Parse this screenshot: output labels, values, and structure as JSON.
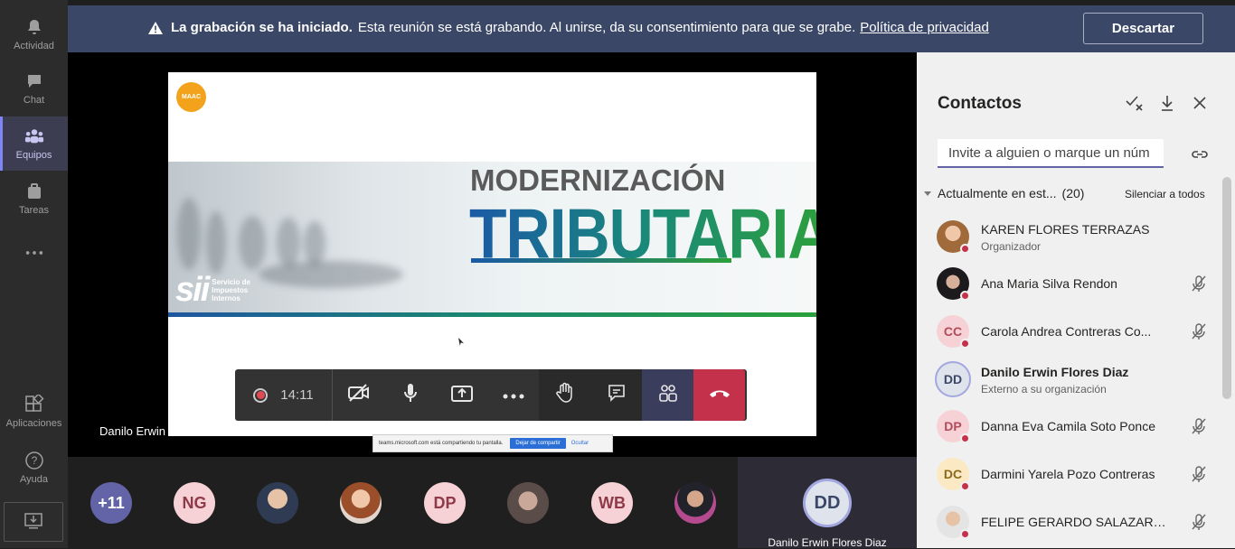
{
  "rail": {
    "items": [
      {
        "label": "Actividad",
        "icon": "bell-icon"
      },
      {
        "label": "Chat",
        "icon": "chat-icon"
      },
      {
        "label": "Equipos",
        "icon": "teams-icon"
      },
      {
        "label": "Tareas",
        "icon": "tasks-icon"
      },
      {
        "label": "...",
        "icon": "more-icon"
      },
      {
        "label": "Aplicaciones",
        "icon": "apps-icon"
      },
      {
        "label": "Ayuda",
        "icon": "help-icon"
      }
    ]
  },
  "banner": {
    "bold_text": "La grabación se ha iniciado.",
    "text": "Esta reunión se está grabando. Al unirse, da su consentimiento para que se grabe.",
    "link": "Política de privacidad",
    "dismiss_label": "Descartar"
  },
  "slide": {
    "logo_text": "MAAC",
    "title_line1": "MODERNIZACIÓN",
    "title_line2": "TRIBUTARIA",
    "org_short": "sii",
    "org_line1": "Servicio de",
    "org_line2": "Impuestos",
    "org_line3": "Internos"
  },
  "presenter_name": "Danilo Erwin Flores Diaz",
  "controls": {
    "timer": "14:11"
  },
  "share_toast": {
    "text": "teams.microsoft.com está compartiendo tu pantalla.",
    "stop_label": "Dejar de compartir",
    "hide_label": "Ocultar"
  },
  "strip": {
    "more": "+11",
    "tiles": [
      "NG",
      "DP",
      "WB"
    ],
    "self_initials": "DD",
    "self_name": "Danilo Erwin Flores Diaz"
  },
  "panel": {
    "title": "Contactos",
    "invite_placeholder": "Invite a alguien o marque un núm",
    "section_label": "Actualmente en est...",
    "section_count": "(20)",
    "mute_all": "Silenciar a todos",
    "contacts": [
      {
        "name": "KAREN FLORES TERRAZAS",
        "sub": "Organizador",
        "initials": ""
      },
      {
        "name": "Ana Maria Silva Rendon",
        "sub": "",
        "initials": ""
      },
      {
        "name": "Carola Andrea Contreras Co...",
        "sub": "",
        "initials": "CC"
      },
      {
        "name": "Danilo Erwin Flores Diaz",
        "sub": "Externo a su organización",
        "initials": "DD"
      },
      {
        "name": "Danna Eva Camila Soto Ponce",
        "sub": "",
        "initials": "DP"
      },
      {
        "name": "Darmini Yarela Pozo Contreras",
        "sub": "",
        "initials": "DC"
      },
      {
        "name": "FELIPE GERARDO SALAZAR ...",
        "sub": "",
        "initials": ""
      }
    ]
  },
  "colors": {
    "accent": "#6264a7",
    "banner": "#3b4767",
    "hangup": "#c4314b"
  }
}
